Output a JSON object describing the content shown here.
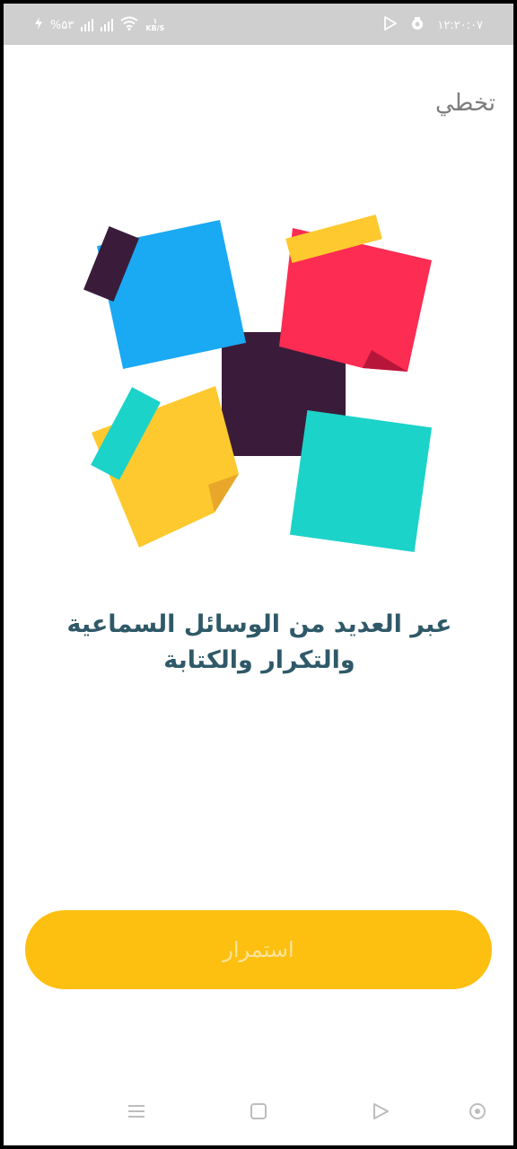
{
  "status_bar": {
    "time": "۱۲:۲۰:۰۷",
    "battery": "%۵۳",
    "speed_value": "۱",
    "speed_unit": "KB/S"
  },
  "header": {
    "skip_label": "تخطي"
  },
  "caption": {
    "line1": "عبر العديد من الوسائل السماعية",
    "line2": "والتكرار والكتابة"
  },
  "continue_button": {
    "label": "استمرار"
  },
  "nav_bar": {
    "items": [
      "menu-icon",
      "home-square-icon",
      "back-triangle-icon",
      "accessibility-icon"
    ]
  },
  "colors": {
    "blue": "#1aa9f3",
    "red": "#fd2c52",
    "dark": "#3a1c3a",
    "yellow": "#fec92f",
    "teal": "#1bd3c9",
    "button": "#fdbf10"
  }
}
